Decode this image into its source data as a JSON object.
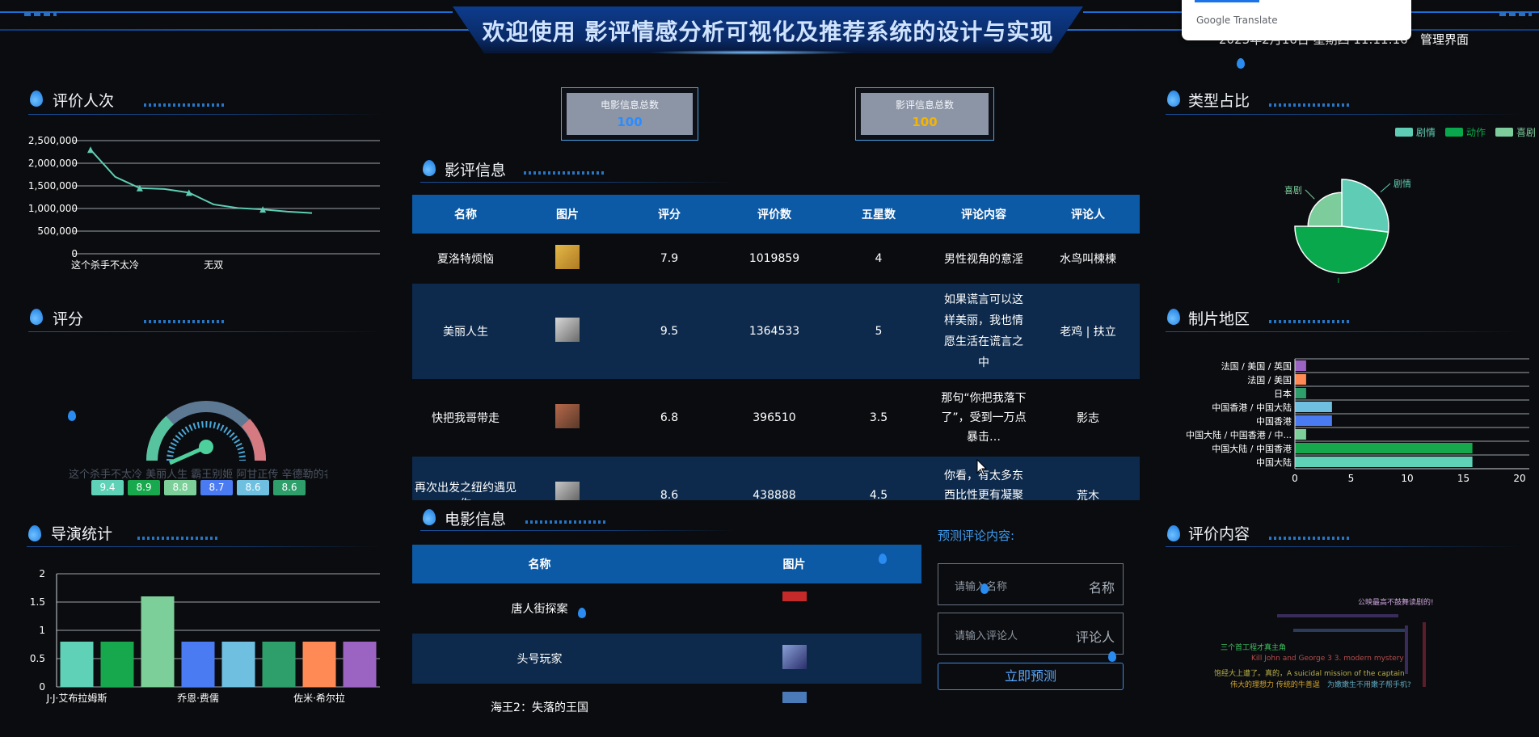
{
  "header": {
    "title": "欢迎使用 影评情感分析可视化及推荐系统的设计与实现",
    "datetime": "2023年2月16日 星期四 11:11:16",
    "admin_link": "管理界面"
  },
  "translate_popup": {
    "label": "Google Translate"
  },
  "panels": {
    "rating_count": "评价人次",
    "score": "评分",
    "director_stats": "导演统计",
    "review_info": "影评信息",
    "movie_info": "电影信息",
    "genre_share": "类型占比",
    "region": "制片地区",
    "review_content": "评价内容"
  },
  "stats": {
    "movie_total_label": "电影信息总数",
    "movie_total_value": "100",
    "review_total_label": "影评信息总数",
    "review_total_value": "100"
  },
  "review_table": {
    "headers": [
      "名称",
      "图片",
      "评分",
      "评价数",
      "五星数",
      "评论内容",
      "评论人"
    ],
    "rows": [
      {
        "name": "夏洛特烦恼",
        "score": "7.9",
        "count": "1019859",
        "five": "4",
        "content": "男性视角的意淫",
        "author": "水鸟叫楝楝"
      },
      {
        "name": "美丽人生",
        "score": "9.5",
        "count": "1364533",
        "five": "5",
        "content": "如果谎言可以这样美丽，我也情愿生活在谎言之中",
        "author": "老鸡 | 扶立"
      },
      {
        "name": "快把我哥带走",
        "score": "6.8",
        "count": "396510",
        "five": "3.5",
        "content": "那句“你把我落下了”，受到一万点暴击…",
        "author": "影志"
      },
      {
        "name": "再次出发之纽约遇见你",
        "score": "8.6",
        "count": "438888",
        "five": "4.5",
        "content": "你看，有太多东西比性更有凝聚力",
        "author": "荒木"
      }
    ]
  },
  "movie_table": {
    "headers": [
      "名称",
      "图片"
    ],
    "rows": [
      {
        "name": "唐人街探案"
      },
      {
        "name": "头号玩家"
      },
      {
        "name": "海王2：失落的王国"
      }
    ]
  },
  "predict": {
    "title": "预测评论内容:",
    "name_placeholder": "请输入名称",
    "name_label": "名称",
    "reviewer_placeholder": "请输入评论人",
    "reviewer_label": "评论人",
    "button": "立即预测"
  },
  "chart_data": [
    {
      "type": "line",
      "title": "评价人次",
      "categories": [
        "这个杀手不太冷",
        "",
        "",
        "",
        "",
        "无双",
        "",
        "",
        "",
        ""
      ],
      "x_labels": [
        "这个杀手不太冷",
        "无双"
      ],
      "values": [
        2300000,
        1700000,
        1450000,
        1430000,
        1350000,
        1090000,
        1010000,
        980000,
        930000,
        900000
      ],
      "y_ticks": [
        "0",
        "500,000",
        "1,000,000",
        "1,500,000",
        "2,000,000",
        "2,500,000"
      ],
      "ylim": [
        0,
        2500000
      ]
    },
    {
      "type": "gauge",
      "title": "评分",
      "overlay_text": "这个杀手不太冷 美丽人生 霸王别姬 阿甘正传 辛德勒的名单 头号玩家",
      "badges": [
        {
          "value": "9.4",
          "color": "#5fd1b7"
        },
        {
          "value": "8.9",
          "color": "#18a84d"
        },
        {
          "value": "8.8",
          "color": "#7ccf98"
        },
        {
          "value": "8.7",
          "color": "#4a7bf2"
        },
        {
          "value": "8.6",
          "color": "#6fc0e0"
        },
        {
          "value": "8.6",
          "color": "#2e9e6b"
        }
      ]
    },
    {
      "type": "bar",
      "title": "导演统计",
      "categories": [
        "J·J·艾布拉姆斯",
        "",
        "乔恩·费儒",
        "",
        "佐米·希尔拉",
        "",
        "",
        ""
      ],
      "x_labels": [
        "J·J·艾布拉姆斯",
        "乔恩·费儒",
        "佐米·希尔拉"
      ],
      "values": [
        0.8,
        0.8,
        1.6,
        0.8,
        0.8,
        0.8,
        0.8,
        0.8
      ],
      "colors": [
        "#5fd1b7",
        "#17a84e",
        "#7ccf98",
        "#4a7bf2",
        "#6fc0e0",
        "#2e9e6b",
        "#ff8a55",
        "#9b63c2"
      ],
      "y_ticks": [
        "0",
        "0.5",
        "1",
        "1.5",
        "2"
      ],
      "ylim": [
        0,
        2
      ]
    },
    {
      "type": "pie",
      "title": "类型占比",
      "legend": [
        "剧情",
        "动作",
        "喜剧"
      ],
      "labels": [
        "剧情",
        "动作",
        "喜剧"
      ],
      "values": [
        27,
        48,
        25
      ],
      "colors": [
        "#5fcdb5",
        "#0aa84c",
        "#7ccc9c"
      ]
    },
    {
      "type": "bar",
      "orientation": "horizontal",
      "title": "制片地区",
      "categories": [
        "法国 / 美国 / 英国",
        "法国 / 美国",
        "日本",
        "中国香港 / 中国大陆",
        "中国香港",
        "中国大陆 / 中国香港 / 中...",
        "中国大陆 / 中国香港",
        "中国大陆"
      ],
      "values": [
        1,
        1,
        1,
        3.3,
        3.3,
        1,
        15.8,
        15.8
      ],
      "colors": [
        "#9b63c2",
        "#ff8a55",
        "#2e9e6b",
        "#6fc0e0",
        "#4a7bf2",
        "#7ccf98",
        "#17a84e",
        "#5fd1b7"
      ],
      "x_ticks": [
        "0",
        "5",
        "10",
        "15",
        "20"
      ],
      "xlim": [
        0,
        20
      ]
    }
  ],
  "word_cloud": [
    {
      "text": "公映最高不鼓舞读剧的!",
      "color": "#c9a2d8"
    },
    {
      "text": "三个首工程才真主角",
      "color": "#3ec060"
    },
    {
      "text": "饱经大上遭了。真的，A suicidal mission of the captain",
      "color": "#b7b04a"
    },
    {
      "text": "伟大的理想力 传统的牛善逞",
      "color": "#d4a62c"
    },
    {
      "text": "为嫩嫩生不用嫩子帮手机?",
      "color": "#5fa8c0"
    },
    {
      "text": "Kill John and George 3 3. modern mystery",
      "color": "#b54d4d"
    }
  ]
}
